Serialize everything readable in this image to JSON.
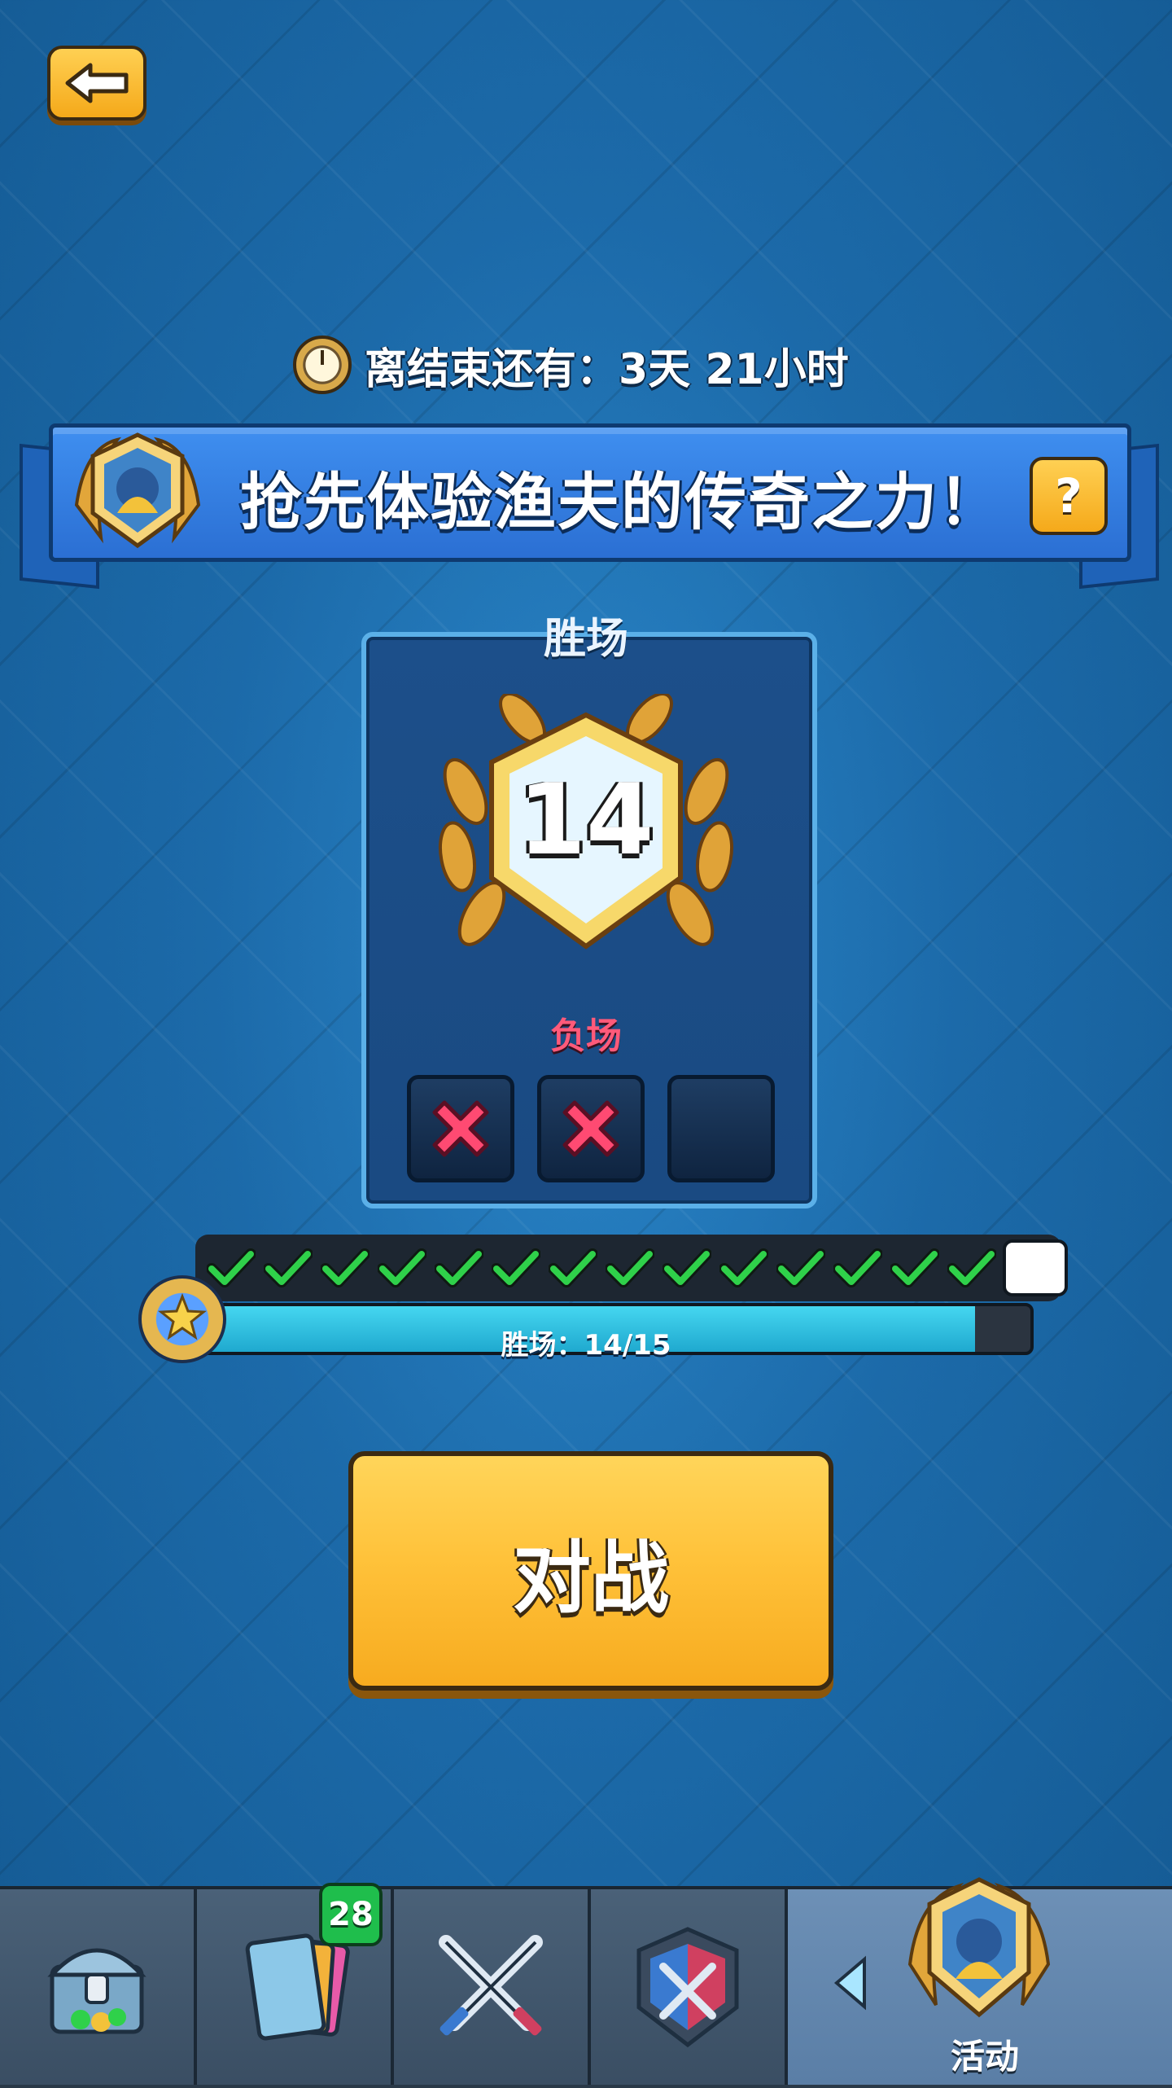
{
  "timer": {
    "prefix": "离结束还有：",
    "days_value": "3",
    "days_unit": "天",
    "hours_value": "21",
    "hours_unit": "小时"
  },
  "banner": {
    "title": "抢先体验渔夫的传奇之力！",
    "help_label": "?"
  },
  "stats": {
    "wins_label": "胜场",
    "wins_value": "14",
    "losses_label": "负场",
    "losses": [
      true,
      true,
      false
    ]
  },
  "progress": {
    "label": "胜场：14/15",
    "current": 14,
    "max": 15
  },
  "battle": {
    "label": "对战"
  },
  "nav": {
    "cards_badge": "28",
    "active_label": "活动",
    "tabs": [
      "shop-chest-icon",
      "cards-icon",
      "battle-swords-icon",
      "clan-shield-icon",
      "event-badge-icon"
    ]
  },
  "colors": {
    "accent_yellow": "#FFC23A",
    "banner_blue": "#2B6FD3",
    "check_green": "#2FD14A",
    "loss_red": "#FF4A72"
  }
}
